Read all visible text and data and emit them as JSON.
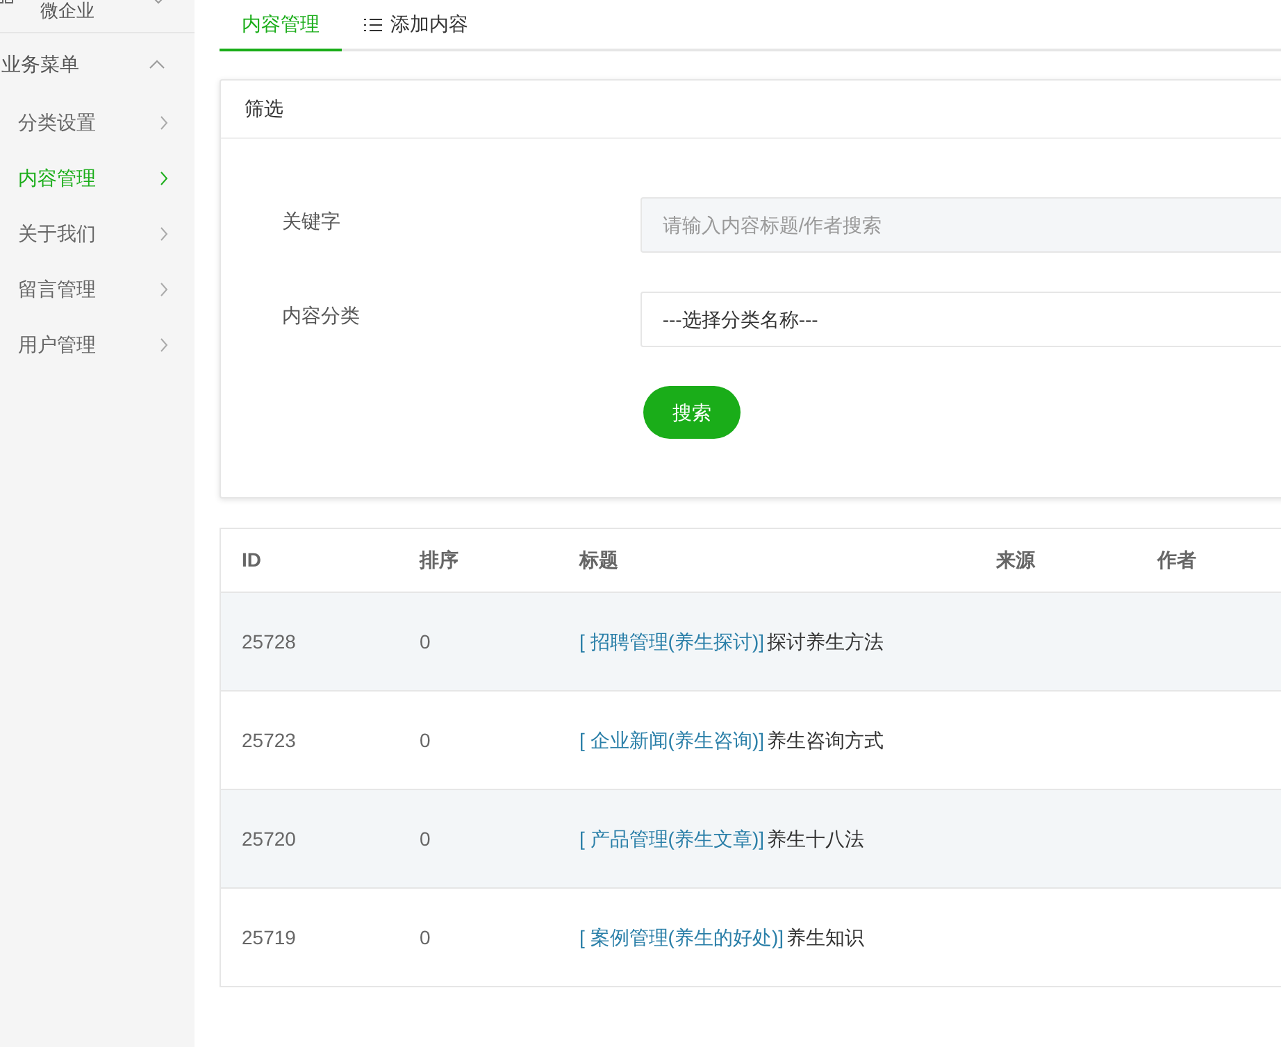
{
  "sidebar": {
    "top_item": {
      "label": "微企业",
      "expanded": false
    },
    "section": {
      "label": "业务菜单",
      "expanded": true
    },
    "items": [
      {
        "label": "分类设置",
        "selected": false
      },
      {
        "label": "内容管理",
        "selected": true
      },
      {
        "label": "关于我们",
        "selected": false
      },
      {
        "label": "留言管理",
        "selected": false
      },
      {
        "label": "用户管理",
        "selected": false
      }
    ]
  },
  "tabs": [
    {
      "label": "内容管理",
      "selected": true,
      "kind": "plain"
    },
    {
      "label": "添加内容",
      "selected": false,
      "kind": "list"
    }
  ],
  "filter": {
    "title": "筛选",
    "keyword_label": "关键字",
    "keyword_placeholder": "请输入内容标题/作者搜索",
    "category_label": "内容分类",
    "category_value": "---选择分类名称---",
    "search_button": "搜索"
  },
  "table": {
    "columns": [
      "ID",
      "排序",
      "标题",
      "来源",
      "作者"
    ],
    "rows": [
      {
        "id": "25728",
        "order": "0",
        "category": "[ 招聘管理(养生探讨)]",
        "title": "探讨养生方法"
      },
      {
        "id": "25723",
        "order": "0",
        "category": "[ 企业新闻(养生咨询)]",
        "title": "养生咨询方式"
      },
      {
        "id": "25720",
        "order": "0",
        "category": "[ 产品管理(养生文章)]",
        "title": "养生十八法"
      },
      {
        "id": "25719",
        "order": "0",
        "category": "[ 案例管理(养生的好处)]",
        "title": "养生知识"
      }
    ]
  }
}
